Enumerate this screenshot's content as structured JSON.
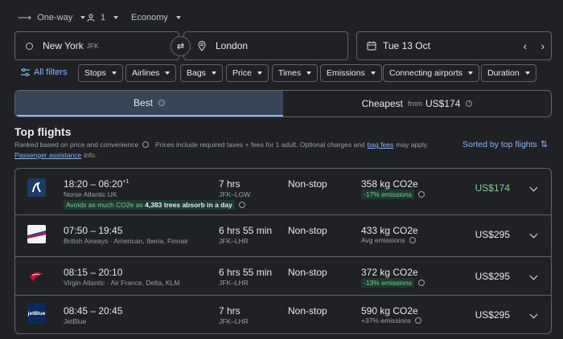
{
  "topbar": {
    "trip_type": "One-way",
    "passengers": "1",
    "cabin": "Economy"
  },
  "search": {
    "origin": "New York",
    "origin_code": "JFK",
    "destination": "London",
    "date": "Tue 13 Oct"
  },
  "filters": {
    "all_filters": "All filters",
    "chips": [
      "Stops",
      "Airlines",
      "Bags",
      "Price",
      "Times",
      "Emissions",
      "Connecting airports",
      "Duration"
    ]
  },
  "tabs": {
    "best": "Best",
    "cheapest": "Cheapest",
    "cheapest_from": "from",
    "cheapest_price": "US$174"
  },
  "results": {
    "title": "Top flights",
    "ranked": "Ranked based on price and convenience",
    "prices_note": "Prices include required taxes + fees for 1 adult. Optional charges and",
    "bag_fees": "bag fees",
    "may_apply": "may apply.",
    "passenger_assistance": "Passenger assistance",
    "info": "info.",
    "sorted": "Sorted by top flights"
  },
  "flights": [
    {
      "times": "18:20 – 06:20",
      "plus": "+1",
      "airline": "Norse Atlantic UK",
      "duration": "7 hrs",
      "route": "JFK–LGW",
      "stops": "Non-stop",
      "co2": "358 kg CO2e",
      "emissions": "-17% emissions",
      "emissions_type": "badge",
      "price": "US$174",
      "price_green": true,
      "eco_pre": "Avoids",
      "eco_mid": "as much CO2e as",
      "eco_bold": "4,383 trees absorb in a day"
    },
    {
      "times": "07:50 – 19:45",
      "plus": "",
      "airline": "British Airways · American, Iberia, Finnair",
      "duration": "6 hrs 55 min",
      "route": "JFK–LHR",
      "stops": "Non-stop",
      "co2": "433 kg CO2e",
      "emissions": "Avg emissions",
      "emissions_type": "plain",
      "price": "US$295",
      "price_green": false
    },
    {
      "times": "08:15 – 20:10",
      "plus": "",
      "airline": "Virgin Atlantic · Air France, Delta, KLM",
      "duration": "6 hrs 55 min",
      "route": "JFK–LHR",
      "stops": "Non-stop",
      "co2": "372 kg CO2e",
      "emissions": "-13% emissions",
      "emissions_type": "badge",
      "price": "US$295",
      "price_green": false
    },
    {
      "times": "08:45 – 20:45",
      "plus": "",
      "airline": "JetBlue",
      "duration": "7 hrs",
      "route": "JFK–LHR",
      "stops": "Non-stop",
      "co2": "590 kg CO2e",
      "emissions": "+37% emissions",
      "emissions_type": "plain",
      "price": "US$295",
      "price_green": false
    }
  ],
  "logos": {
    "jetblue": "jetBlue"
  }
}
